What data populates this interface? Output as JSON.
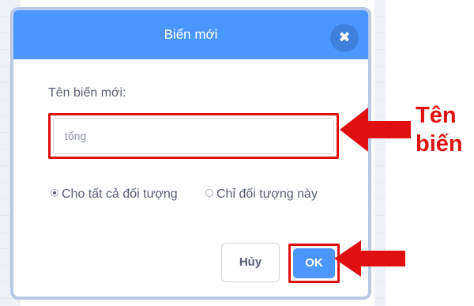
{
  "dialog": {
    "title": "Biến mới",
    "close_symbol": "✖",
    "field_label": "Tên biến mới:",
    "variable_name_value": "tổng",
    "radio_options": [
      {
        "label": "Cho tất cả đối tượng",
        "selected": true
      },
      {
        "label": "Chỉ đối tượng này",
        "selected": false
      }
    ],
    "cancel_label": "Hủy",
    "ok_label": "OK"
  },
  "annotation": {
    "label": "Tên biến",
    "color": "#e01010"
  },
  "icons": {
    "close": "close-icon",
    "arrow": "arrow-left-icon"
  },
  "colors": {
    "header": "#4c97ff",
    "highlight": "#e01010",
    "text": "#575e75"
  }
}
